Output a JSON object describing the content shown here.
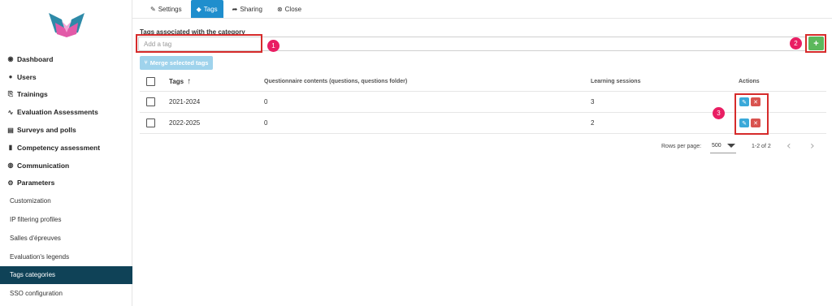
{
  "sidebar": {
    "items": [
      {
        "icon": "gauge-icon",
        "glyph": "◉",
        "label": "Dashboard"
      },
      {
        "icon": "users-icon",
        "glyph": "👥",
        "label": "Users"
      },
      {
        "icon": "trainings-icon",
        "glyph": "⎘",
        "label": "Trainings"
      },
      {
        "icon": "evaluation-icon",
        "glyph": "∿",
        "label": "Evaluation Assessments"
      },
      {
        "icon": "chart-icon",
        "glyph": "▤",
        "label": "Surveys and polls"
      },
      {
        "icon": "clipboard-icon",
        "glyph": "▮",
        "label": "Competency assessment"
      },
      {
        "icon": "chat-icon",
        "glyph": "◍",
        "label": "Communication"
      },
      {
        "icon": "gears-icon",
        "glyph": "⚙",
        "label": "Parameters"
      }
    ],
    "sub_items": [
      {
        "label": "Customization",
        "active": false
      },
      {
        "label": "IP filtering profiles",
        "active": false
      },
      {
        "label": "Salles d'épreuves",
        "active": false
      },
      {
        "label": "Evaluation's legends",
        "active": false
      },
      {
        "label": "Tags categories",
        "active": true
      },
      {
        "label": "SSO configuration",
        "active": false
      }
    ]
  },
  "tabs": [
    {
      "label": "Settings",
      "icon": "wrench-icon",
      "glyph": "✎",
      "active": false
    },
    {
      "label": "Tags",
      "icon": "tag-icon",
      "glyph": "◆",
      "active": true
    },
    {
      "label": "Sharing",
      "icon": "share-icon",
      "glyph": "➦",
      "active": false
    },
    {
      "label": "Close",
      "icon": "close-circle-icon",
      "glyph": "⊗",
      "active": false
    }
  ],
  "section_title": "Tags associated with the category",
  "tag_input": {
    "placeholder": "Add a tag",
    "value": ""
  },
  "add_button_label": "+",
  "merge_button_label": "Merge selected tags",
  "table": {
    "headers": {
      "tags": "Tags",
      "questionnaire": "Questionnaire contents (questions, questions folder)",
      "sessions": "Learning sessions",
      "actions": "Actions"
    },
    "rows": [
      {
        "tag": "2021-2024",
        "questionnaire": "0",
        "sessions": "3"
      },
      {
        "tag": "2022-2025",
        "questionnaire": "0",
        "sessions": "2"
      }
    ]
  },
  "pagination": {
    "rows_per_page_label": "Rows per page:",
    "rows_per_page": "500",
    "range": "1-2 of 2"
  },
  "annotations": [
    "1",
    "2",
    "3"
  ],
  "colors": {
    "active_tab": "#1f8ecd",
    "active_sidebar": "#0f4257",
    "add_button": "#5cb85c",
    "merge_button": "#9fd3ec",
    "edit_action": "#3aa9d9",
    "delete_action": "#d9534f",
    "annotation": "#e91e63",
    "highlight": "#d62b2b"
  }
}
